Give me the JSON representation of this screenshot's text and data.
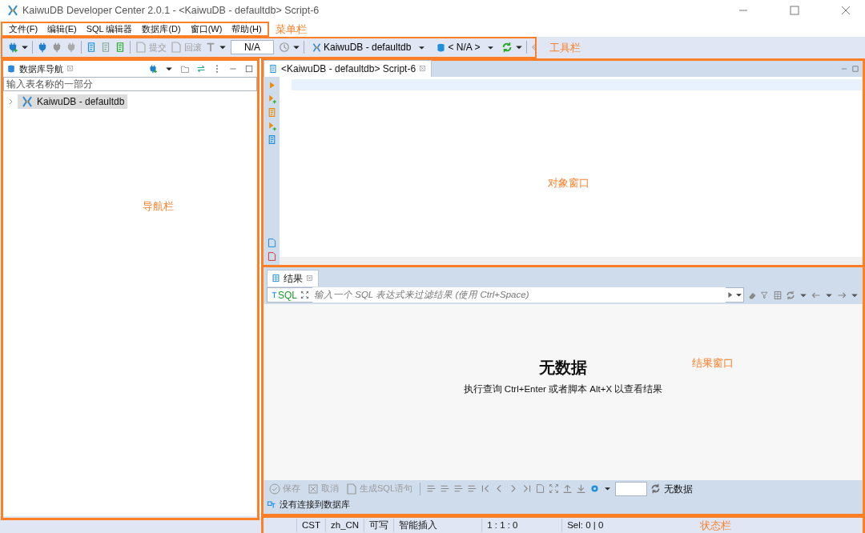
{
  "window": {
    "title": "KaiwuDB Developer Center 2.0.1 - <KaiwuDB - defaultdb> Script-6"
  },
  "menubar": {
    "annotation": "菜单栏",
    "items": [
      {
        "label": "文件(F)"
      },
      {
        "label": "编辑(E)"
      },
      {
        "label": "SQL 编辑器"
      },
      {
        "label": "数据库(D)"
      },
      {
        "label": "窗口(W)"
      },
      {
        "label": "帮助(H)"
      }
    ]
  },
  "toolbar": {
    "annotation": "工具栏",
    "items": [
      {
        "kind": "icon"
      },
      {
        "kind": "caret"
      },
      {
        "kind": "sep"
      },
      {
        "kind": "icon"
      },
      {
        "kind": "icon"
      },
      {
        "kind": "icon"
      },
      {
        "kind": "sep"
      },
      {
        "kind": "icon"
      },
      {
        "kind": "icon"
      },
      {
        "kind": "icon"
      },
      {
        "kind": "sep"
      },
      {
        "kind": "button",
        "label": "提交",
        "disabled": true
      },
      {
        "kind": "button",
        "label": "回滚",
        "disabled": true
      },
      {
        "kind": "icon"
      },
      {
        "kind": "caret"
      },
      {
        "kind": "field",
        "value": "N/A"
      },
      {
        "kind": "icon"
      },
      {
        "kind": "caret"
      },
      {
        "kind": "sep"
      },
      {
        "kind": "combo",
        "label": "KaiwuDB - defaultdb"
      },
      {
        "kind": "combo",
        "label": "< N/A >"
      },
      {
        "kind": "icon"
      },
      {
        "kind": "caret"
      },
      {
        "kind": "sep"
      },
      {
        "kind": "icon"
      }
    ]
  },
  "navigator": {
    "annotation": "导航栏",
    "tab": {
      "label": "数据库导航",
      "selected": true
    },
    "filter": {
      "placeholder": "输入表名称的一部分"
    },
    "tree": [
      {
        "label": "KaiwuDB - defaultdb",
        "selected": true,
        "expanded": false
      }
    ]
  },
  "editor": {
    "annotation": "对象窗口",
    "tabs": [
      {
        "label": "<KaiwuDB - defaultdb> Script-6",
        "selected": true
      }
    ]
  },
  "results": {
    "annotation": "结果窗口",
    "tabs": [
      {
        "label": "结果",
        "selected": true
      }
    ],
    "filter_label": "SQL",
    "filter": {
      "placeholder": "输入一个 SQL 表达式来过滤结果 (使用 Ctrl+Space)"
    },
    "empty_title": "无数据",
    "empty_hint": "执行查询 Ctrl+Enter 或者脚本 Alt+X 以查看结果",
    "actions": [
      {
        "label": "保存",
        "disabled": true
      },
      {
        "label": "取消",
        "disabled": true
      },
      {
        "label": "生成SQL语句",
        "disabled": true
      }
    ],
    "row_count": "无数据",
    "connection": "没有连接到数据库"
  },
  "status_bar": {
    "annotation": "状态栏",
    "cells": [
      "CST",
      "zh_CN",
      "可写",
      "智能插入",
      "1 : 1 : 0",
      "Sel: 0 | 0"
    ]
  }
}
